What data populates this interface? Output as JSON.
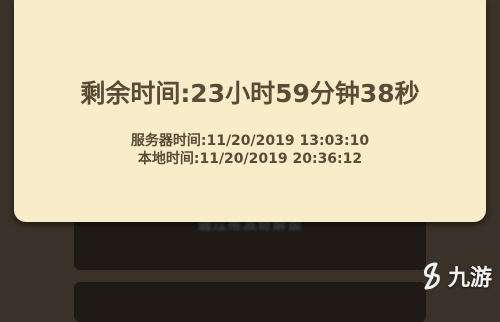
{
  "dialog": {
    "remaining_time": "剩余时间:23小时59分钟38秒",
    "server_time": "服务器时间:11/20/2019 13:03:10",
    "local_time": "本地时间:11/20/2019 20:36:12"
  },
  "background": {
    "blurred_button_text": "通过帮派奇解锁"
  },
  "watermark": {
    "logo_text": "九游",
    "icon": "jiuyou-logo-icon"
  }
}
